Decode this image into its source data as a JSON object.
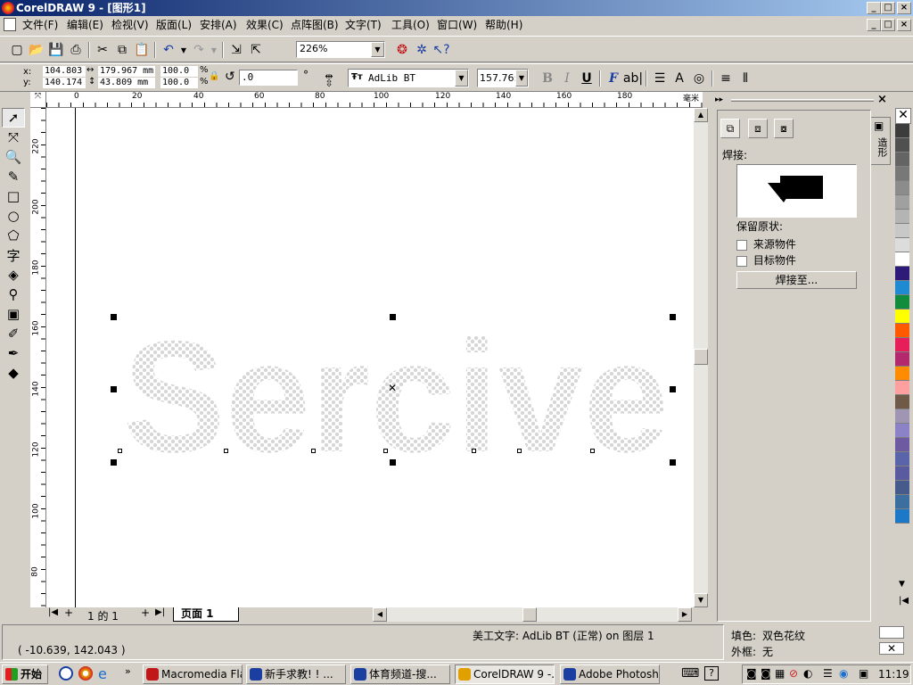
{
  "window": {
    "title": "CorelDRAW 9 - [图形1]"
  },
  "menu": [
    "文件(F)",
    "编辑(E)",
    "检视(V)",
    "版面(L)",
    "安排(A)",
    "效果(C)",
    "点阵图(B)",
    "文字(T)",
    "工具(O)",
    "窗口(W)",
    "帮助(H)"
  ],
  "toolbar": {
    "zoom": "226%"
  },
  "propbar": {
    "x": "104.803",
    "y": "140.174",
    "w": "179.967 mm",
    "h": "43.809 mm",
    "sx": "100.0",
    "sy": "100.0",
    "pct": "%",
    "angle": ".0",
    "deg": "°",
    "font": "AdLib BT",
    "size": "157.76:",
    "bold": "B",
    "italic": "I",
    "underline": "U"
  },
  "rulers": {
    "unit": "毫米",
    "h_ticks": [
      "0",
      "20",
      "40",
      "60",
      "80",
      "100",
      "120",
      "140",
      "160",
      "180"
    ],
    "v_ticks": [
      "220",
      "200",
      "180",
      "160",
      "140",
      "120",
      "100",
      "80"
    ]
  },
  "artwork": {
    "text": "Sercive",
    "fill_color": "#d8d8d8"
  },
  "pagenav": {
    "page_count": "1 的 1",
    "page_tab": "页面  1"
  },
  "docker": {
    "label": "焊接:",
    "keep_original": "保留原状:",
    "source": "来源物件",
    "target": "目标物件",
    "button": "焊接至...",
    "tab": "造形"
  },
  "palette": [
    "#3c3c3c",
    "#505050",
    "#646464",
    "#787878",
    "#8c8c8c",
    "#a0a0a0",
    "#b4b4b4",
    "#c8c8c8",
    "#dcdcdc",
    "#ffffff",
    "#2e1a78",
    "#1e8ad2",
    "#118c3c",
    "#ffff00",
    "#ff5a00",
    "#e61e5a",
    "#b4286e",
    "#ff8c00",
    "#ffa0a0",
    "#6e5a46",
    "#a096b4",
    "#8c82c8",
    "#6e5aa0",
    "#5a64aa",
    "#5a5aa0",
    "#465a8c",
    "#3c6ea0",
    "#1e78c8"
  ],
  "status": {
    "coords": "( -10.639, 142.043 )",
    "object": "美工文字: AdLib BT (正常) on 图层 1",
    "fill_label": "填色:",
    "fill_value": "双色花纹",
    "outline_label": "外框:",
    "outline_value": "无"
  },
  "taskbar": {
    "start": "开始",
    "tasks": [
      "Macromedia Fla...",
      "新手求教! ! ...",
      "体育频道-搜...",
      "CorelDRAW 9 -...",
      "Adobe Photoshop"
    ],
    "clock": "11:19"
  }
}
